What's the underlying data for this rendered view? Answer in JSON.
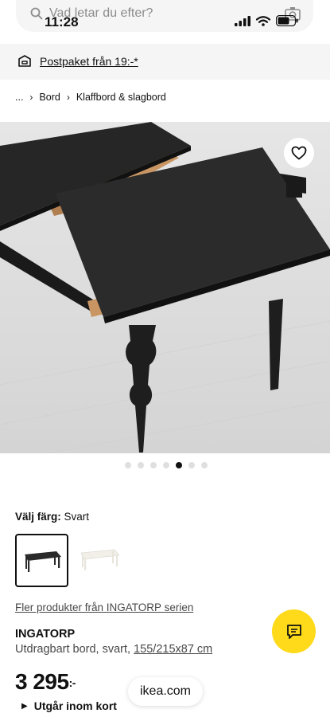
{
  "status_bar": {
    "time": "11:28"
  },
  "search": {
    "placeholder": "Vad letar du efter?"
  },
  "delivery": {
    "text": "Postpaket från 19:-*"
  },
  "breadcrumb": {
    "ellipsis": "...",
    "items": [
      "Bord",
      "Klaffbord & slagbord"
    ]
  },
  "gallery": {
    "dot_count": 7,
    "active_index": 4
  },
  "color": {
    "label": "Välj färg:",
    "value": "Svart"
  },
  "series_link": "Fler produkter från INGATORP serien",
  "product": {
    "name": "INGATORP",
    "description_prefix": "Utdragbart bord, svart, ",
    "dimensions": "155/215x87 cm",
    "price": "3 295",
    "price_suffix": ":-",
    "stock_status": "Utgår inom kort"
  },
  "browser": {
    "url": "ikea.com"
  },
  "colors": {
    "chat_button": "#ffda1a",
    "banner_bg": "#f5f5f5"
  }
}
